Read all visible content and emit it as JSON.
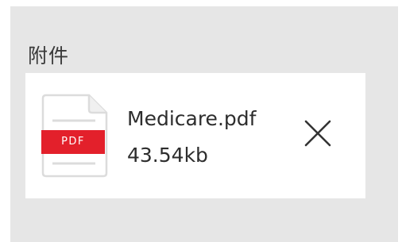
{
  "attachments_section": {
    "title": "附件"
  },
  "attachment": {
    "file_name": "Medicare.pdf",
    "file_size": "43.54kb",
    "file_type_label": "PDF",
    "icon": "pdf-file-icon",
    "remove_icon": "close-icon"
  },
  "colors": {
    "panel_background": "#e6e6e6",
    "card_background": "#ffffff",
    "pdf_badge": "#e3202b",
    "text": "#2d2d2d"
  }
}
